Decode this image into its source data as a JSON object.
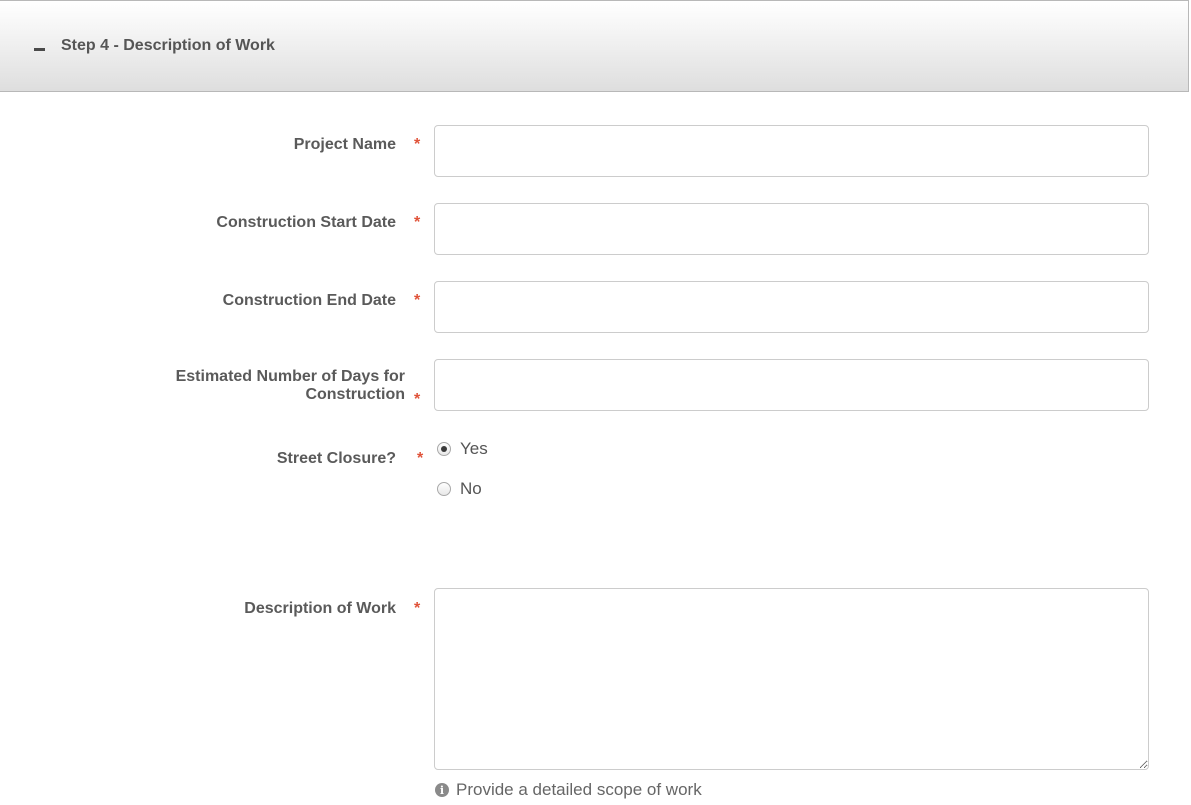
{
  "panel": {
    "collapse_symbol": "–",
    "title": "Step 4 - Description of Work"
  },
  "required_marker": "*",
  "fields": {
    "project_name": {
      "label": "Project Name",
      "value": ""
    },
    "start_date": {
      "label": "Construction Start Date",
      "value": ""
    },
    "end_date": {
      "label": "Construction End Date",
      "value": ""
    },
    "days": {
      "label_line1": "Estimated Number of Days for",
      "label_line2": "Construction",
      "value": ""
    },
    "street_closure": {
      "label": "Street Closure?",
      "options": [
        {
          "label": "Yes",
          "selected": true
        },
        {
          "label": "No",
          "selected": false
        }
      ]
    },
    "description": {
      "label": "Description of Work",
      "value": "",
      "help": "Provide a detailed scope of work"
    }
  },
  "icons": {
    "info": "info-circle-icon",
    "collapse": "minus-icon"
  }
}
